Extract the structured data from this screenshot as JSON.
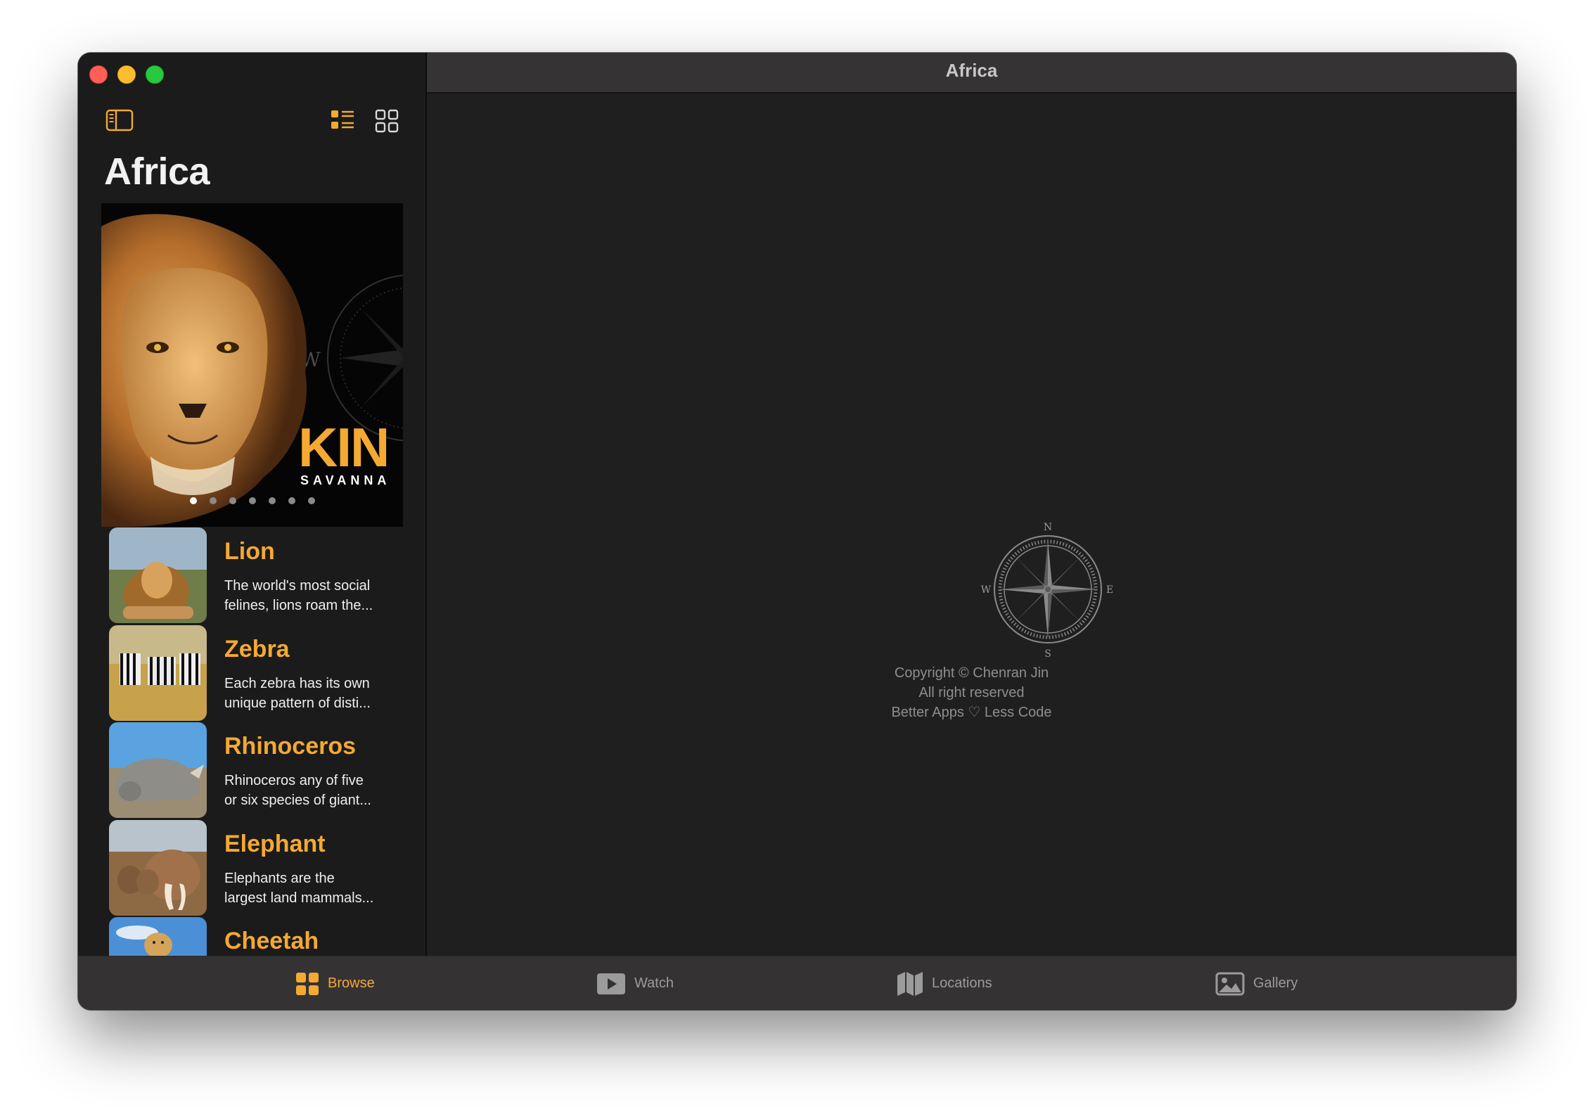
{
  "window": {
    "title": "Africa"
  },
  "sidebar": {
    "title": "Africa",
    "toolbar": {
      "toggle_sidebar_icon": "sidebar-left-icon",
      "list_view_icon": "list-bullet-icon",
      "grid_view_icon": "square-grid-icon"
    },
    "hero": {
      "word": "KIN",
      "subtitle": "SAVANNA",
      "compass_letter": "W",
      "page_count": 7,
      "active_page": 1
    },
    "animals": [
      {
        "name": "Lion",
        "desc_line1": "The world's most social",
        "desc_line2": "felines, lions roam the..."
      },
      {
        "name": "Zebra",
        "desc_line1": "Each zebra has its own",
        "desc_line2": "unique pattern of disti..."
      },
      {
        "name": "Rhinoceros",
        "desc_line1": "Rhinoceros any of five",
        "desc_line2": "or six species of giant..."
      },
      {
        "name": "Elephant",
        "desc_line1": "Elephants are the",
        "desc_line2": "largest land mammals..."
      },
      {
        "name": "Cheetah",
        "desc_line1": "",
        "desc_line2": ""
      }
    ]
  },
  "content": {
    "compass": {
      "n": "N",
      "s": "S",
      "e": "E",
      "w": "W"
    },
    "credits": {
      "line1": "Copyright © Chenran Jin",
      "line2": "All right reserved",
      "line3": "Better Apps ♡ Less Code"
    }
  },
  "tabbar": {
    "tabs": [
      {
        "label": "Browse",
        "icon": "square-grid-icon",
        "active": true
      },
      {
        "label": "Watch",
        "icon": "play-rectangle-icon",
        "active": false
      },
      {
        "label": "Locations",
        "icon": "map-icon",
        "active": false
      },
      {
        "label": "Gallery",
        "icon": "photo-icon",
        "active": false
      }
    ]
  },
  "colors": {
    "accent": "#f4a933",
    "background": "#1f1f1f",
    "sidebar": "#1b1b1b",
    "titlebar": "#363334",
    "tabbar": "#353233"
  }
}
